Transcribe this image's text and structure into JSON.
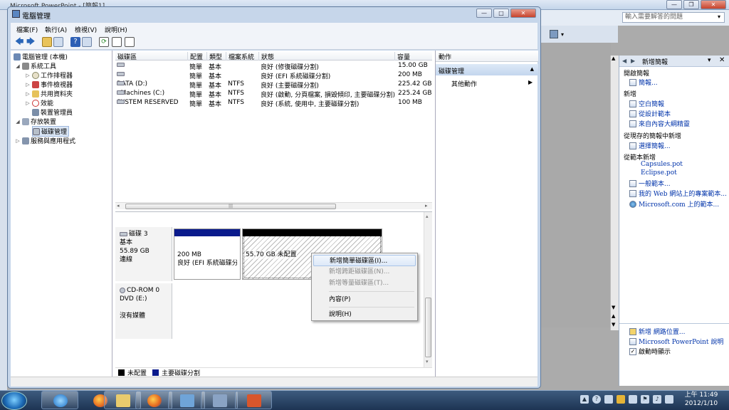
{
  "ppt": {
    "title": "Microsoft PowerPoint - [簡報1]",
    "help_placeholder": "輸入需要解答的問題",
    "taskpane_title": "新增簡報",
    "sections": {
      "open": "開啟簡報",
      "new": "新增",
      "from_existing": "從現存的簡報中新增",
      "from_template": "從範本新增"
    },
    "links": {
      "presentations": "簡報...",
      "blank": "空白簡報",
      "from_design": "從設計範本",
      "from_autocontent": "來自內容大綱精靈",
      "choose": "選擇簡報...",
      "capsules": "Capsules.pot",
      "eclipse": "Eclipse.pot",
      "general": "一般範本...",
      "web_templates": "我的 Web 網站上的專案範本...",
      "ms_templates": "Microsoft.com 上的範本...",
      "add_network": "新增 網路位置...",
      "help": "Microsoft PowerPoint 說明",
      "show_startup": "啟動時顯示"
    }
  },
  "window": {
    "title": "電腦管理",
    "menu": [
      "檔案(F)",
      "執行(A)",
      "檢視(V)",
      "說明(H)"
    ]
  },
  "tree": {
    "root": "電腦管理 (本機)",
    "system_tools": "系統工具",
    "task_scheduler": "工作排程器",
    "event_viewer": "事件檢視器",
    "shared_folders": "共用資料夾",
    "performance": "效能",
    "device_manager": "裝置管理員",
    "storage": "存放裝置",
    "disk_management": "磁碟管理",
    "services": "服務與應用程式"
  },
  "volumes": {
    "headers": [
      "磁碟區",
      "配置",
      "類型",
      "檔案系統",
      "狀態",
      "容量"
    ],
    "rows": [
      {
        "name": "",
        "layout": "簡單",
        "type": "基本",
        "fs": "",
        "status": "良好 (修復磁碟分割)",
        "capacity": "15.00 GB"
      },
      {
        "name": "",
        "layout": "簡單",
        "type": "基本",
        "fs": "",
        "status": "良好 (EFI 系統磁碟分割)",
        "capacity": "200 MB"
      },
      {
        "name": "DATA (D:)",
        "layout": "簡單",
        "type": "基本",
        "fs": "NTFS",
        "status": "良好 (主要磁碟分割)",
        "capacity": "225.42 GB"
      },
      {
        "name": "eMachines (C:)",
        "layout": "簡單",
        "type": "基本",
        "fs": "NTFS",
        "status": "良好 (啟動, 分頁檔案, 損毀傾印, 主要磁碟分割)",
        "capacity": "225.24 GB"
      },
      {
        "name": "SYSTEM RESERVED",
        "layout": "簡單",
        "type": "基本",
        "fs": "NTFS",
        "status": "良好 (系統, 使用中, 主要磁碟分割)",
        "capacity": "100 MB"
      }
    ]
  },
  "disks": {
    "disk3": {
      "name": "磁碟 3",
      "type": "基本",
      "size": "55.89 GB",
      "state": "連線"
    },
    "part1": {
      "size": "200 MB",
      "status": "良好 (EFI 系統磁碟分"
    },
    "part2": {
      "size": "55.70 GB",
      "status": "未配置"
    },
    "cdrom": {
      "name": "CD-ROM 0",
      "drive": "DVD (E:)",
      "media": "沒有媒體"
    }
  },
  "legend": {
    "unallocated": "未配置",
    "primary": "主要磁碟分割"
  },
  "actions": {
    "header": "動作",
    "section": "磁碟管理",
    "more": "其他動作"
  },
  "context_menu": {
    "new_simple": "新增簡單磁碟區(I)...",
    "new_spanned": "新增跨距磁碟區(N)...",
    "new_striped": "新增等量磁碟區(T)...",
    "properties": "內容(P)",
    "help": "說明(H)"
  },
  "tray": {
    "time": "上午 11:49",
    "date": "2012/1/10"
  },
  "colors": {
    "primary_partition": "#0a1a8c",
    "unallocated": "#000000",
    "selection": "#dbe7f6"
  }
}
